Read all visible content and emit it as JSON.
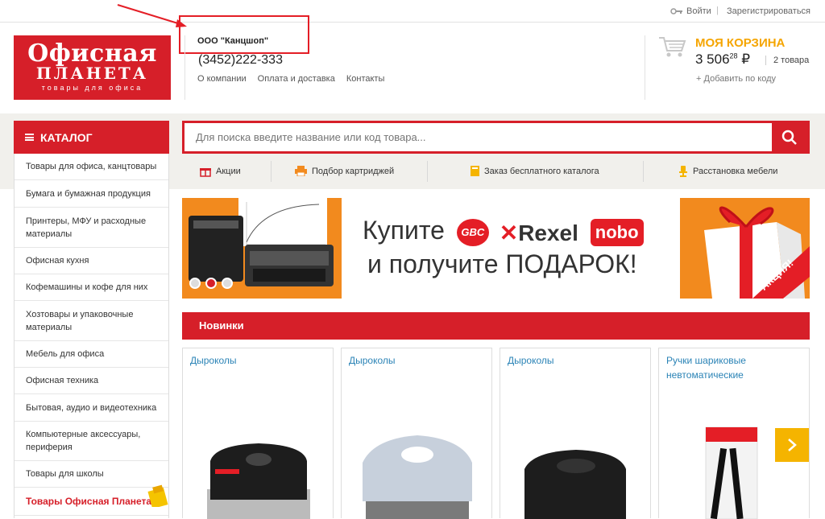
{
  "topbar": {
    "login": "Войти",
    "separator": "|",
    "register": "Зарегистрироваться"
  },
  "logo": {
    "line1": "Офисная",
    "line2": "ПЛАНЕТА",
    "line3": "товары для офиса"
  },
  "header": {
    "company": "ООО \"Канцшоп\"",
    "phone": "(3452)222-333",
    "nav": [
      "О компании",
      "Оплата и доставка",
      "Контакты"
    ]
  },
  "cart": {
    "title": "МОЯ КОРЗИНА",
    "sum": "3 506",
    "kopeks": "28",
    "currency": "₽",
    "count": "2 товара",
    "add": "Добавить по коду"
  },
  "catalog": {
    "label": "КАТАЛОГ"
  },
  "menu": [
    "Товары для офиса, канцтовары",
    "Бумага и бумажная продукция",
    "Принтеры, МФУ и расходные материалы",
    "Офисная кухня",
    "Кофемашины и кофе для них",
    "Хозтовары и упаковочные материалы",
    "Мебель для офиса",
    "Офисная техника",
    "Бытовая, аудио и видеотехника",
    "Компьютерные аксессуары, периферия",
    "Товары для школы"
  ],
  "menu_special": "Товары Офисная Планета",
  "search": {
    "placeholder": "Для поиска введите название или код товара..."
  },
  "links": [
    "Акции",
    "Подбор картриджей",
    "Заказ бесплатного каталога",
    "Расстановка мебели"
  ],
  "banner": {
    "line1": "Купите",
    "brand1": "GBC",
    "brand2": "Rexel",
    "brand3": "nobo",
    "line2": "и получите ПОДАРОК!",
    "badge": "АКЦИЯ!"
  },
  "section": {
    "title": "Новинки"
  },
  "products": [
    {
      "title": "Дыроколы"
    },
    {
      "title": "Дыроколы"
    },
    {
      "title": "Дыроколы"
    },
    {
      "title": "Ручки шариковые невтоматические"
    }
  ],
  "colors": {
    "brand_red": "#d61f29",
    "accent_orange": "#f5a500",
    "link_blue": "#2a83b6"
  }
}
